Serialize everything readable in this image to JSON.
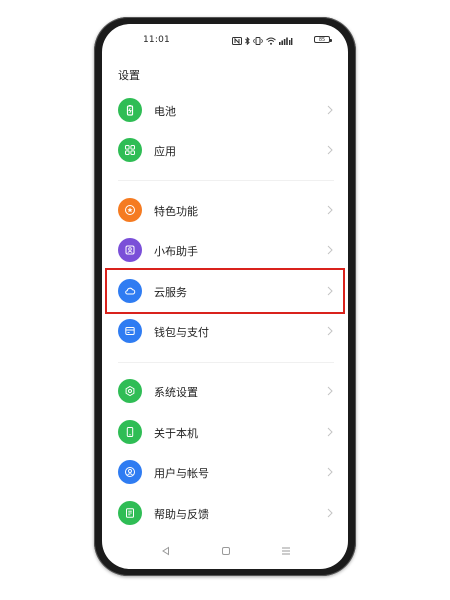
{
  "status_bar": {
    "time": "11:01",
    "battery": "85",
    "icons": [
      "nfc-icon",
      "bluetooth-icon",
      "vibrate-icon",
      "wifi-icon",
      "signal-icon",
      "battery-icon"
    ]
  },
  "page": {
    "title": "设置"
  },
  "settings_items": [
    {
      "label": "电池",
      "icon": "battery-icon",
      "color": "#2fbd55"
    },
    {
      "label": "应用",
      "icon": "grid-icon",
      "color": "#2fbd55"
    },
    {
      "label": "特色功能",
      "icon": "star-icon",
      "color": "#f57b21"
    },
    {
      "label": "小布助手",
      "icon": "assistant-icon",
      "color": "#7a4fd8"
    },
    {
      "label": "云服务",
      "icon": "cloud-icon",
      "color": "#2f7cf2"
    },
    {
      "label": "钱包与支付",
      "icon": "wallet-icon",
      "color": "#2f7cf2"
    },
    {
      "label": "系统设置",
      "icon": "hexagon-gear-icon",
      "color": "#2fbd55"
    },
    {
      "label": "关于本机",
      "icon": "phone-icon",
      "color": "#2fbd55"
    },
    {
      "label": "用户与帐号",
      "icon": "user-icon",
      "color": "#2f7cf2"
    },
    {
      "label": "帮助与反馈",
      "icon": "document-icon",
      "color": "#2fbd55"
    }
  ],
  "highlight": {
    "target": "云服务",
    "color": "#d9221c"
  },
  "nav_bar": [
    "back-icon",
    "home-icon",
    "menu-icon"
  ]
}
